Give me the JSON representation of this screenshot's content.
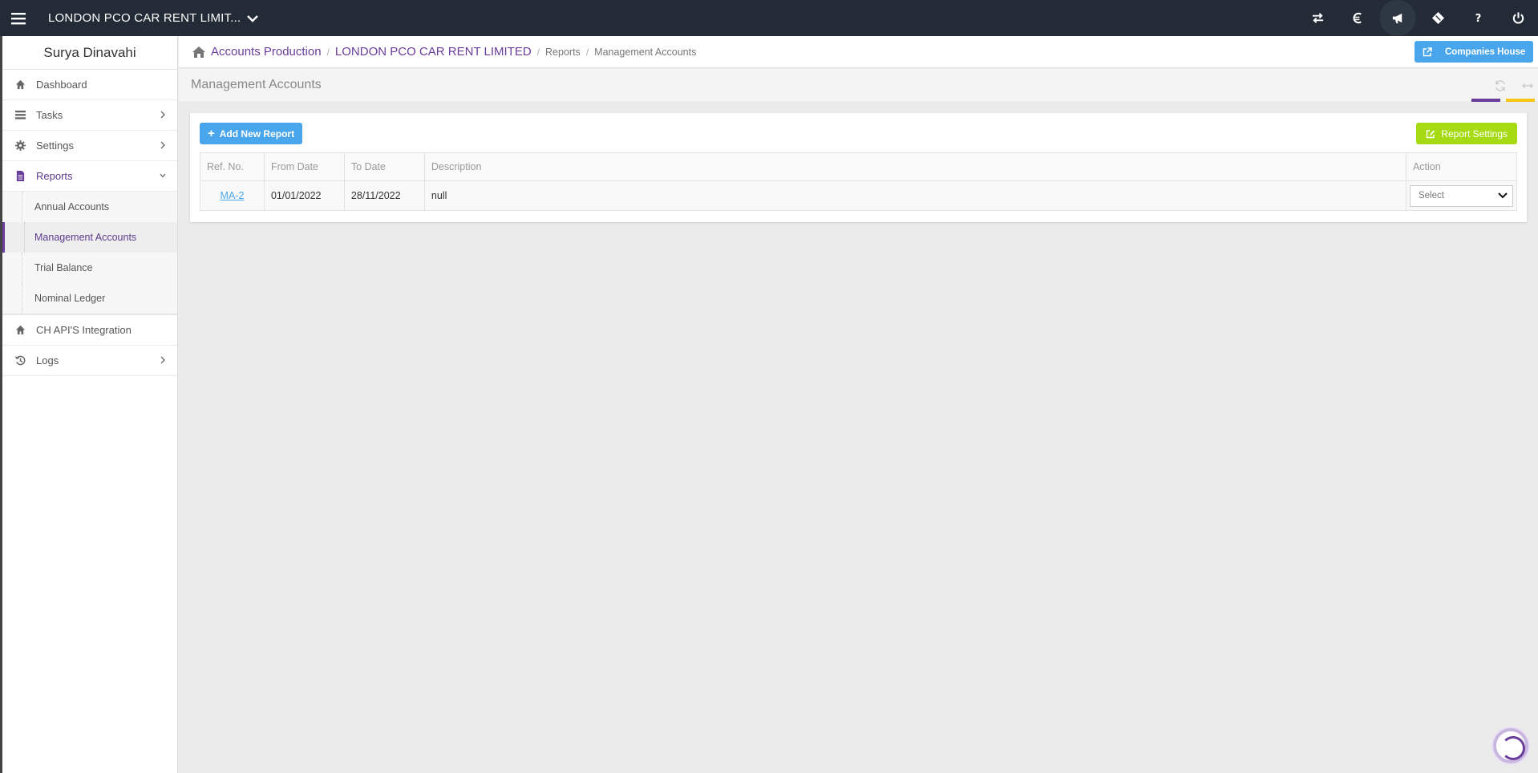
{
  "header": {
    "company_name": "LONDON PCO CAR RENT LIMIT...",
    "icons": [
      "menu-icon",
      "switch-icon",
      "currency-icon",
      "megaphone-icon",
      "ticket-icon",
      "help-icon",
      "power-icon"
    ]
  },
  "sidebar": {
    "user_name": "Surya Dinavahi",
    "items": [
      {
        "label": "Dashboard",
        "icon": "home-icon"
      },
      {
        "label": "Tasks",
        "icon": "tasks-icon"
      },
      {
        "label": "Settings",
        "icon": "gear-icon"
      },
      {
        "label": "Reports",
        "icon": "document-icon"
      },
      {
        "label": "CH API'S Integration",
        "icon": "home-icon"
      },
      {
        "label": "Logs",
        "icon": "history-icon"
      }
    ],
    "reports_submenu": [
      {
        "label": "Annual Accounts"
      },
      {
        "label": "Management Accounts"
      },
      {
        "label": "Trial Balance"
      },
      {
        "label": "Nominal Ledger"
      }
    ]
  },
  "breadcrumb": {
    "items": [
      "Accounts Production",
      "LONDON PCO CAR RENT LIMITED",
      "Reports",
      "Management Accounts"
    ]
  },
  "companies_house_button": "Companies House",
  "page_title": "Management Accounts",
  "accent_colors": [
    "#6a3d9a",
    "#f5c518"
  ],
  "buttons": {
    "add_new_report": "Add New Report",
    "report_settings": "Report Settings"
  },
  "table": {
    "headers": [
      "Ref. No.",
      "From Date",
      "To Date",
      "Description",
      "Action"
    ],
    "rows": [
      {
        "ref": "MA-2",
        "from": "01/01/2022",
        "to": "28/11/2022",
        "description": "null",
        "action": "Select"
      }
    ]
  }
}
